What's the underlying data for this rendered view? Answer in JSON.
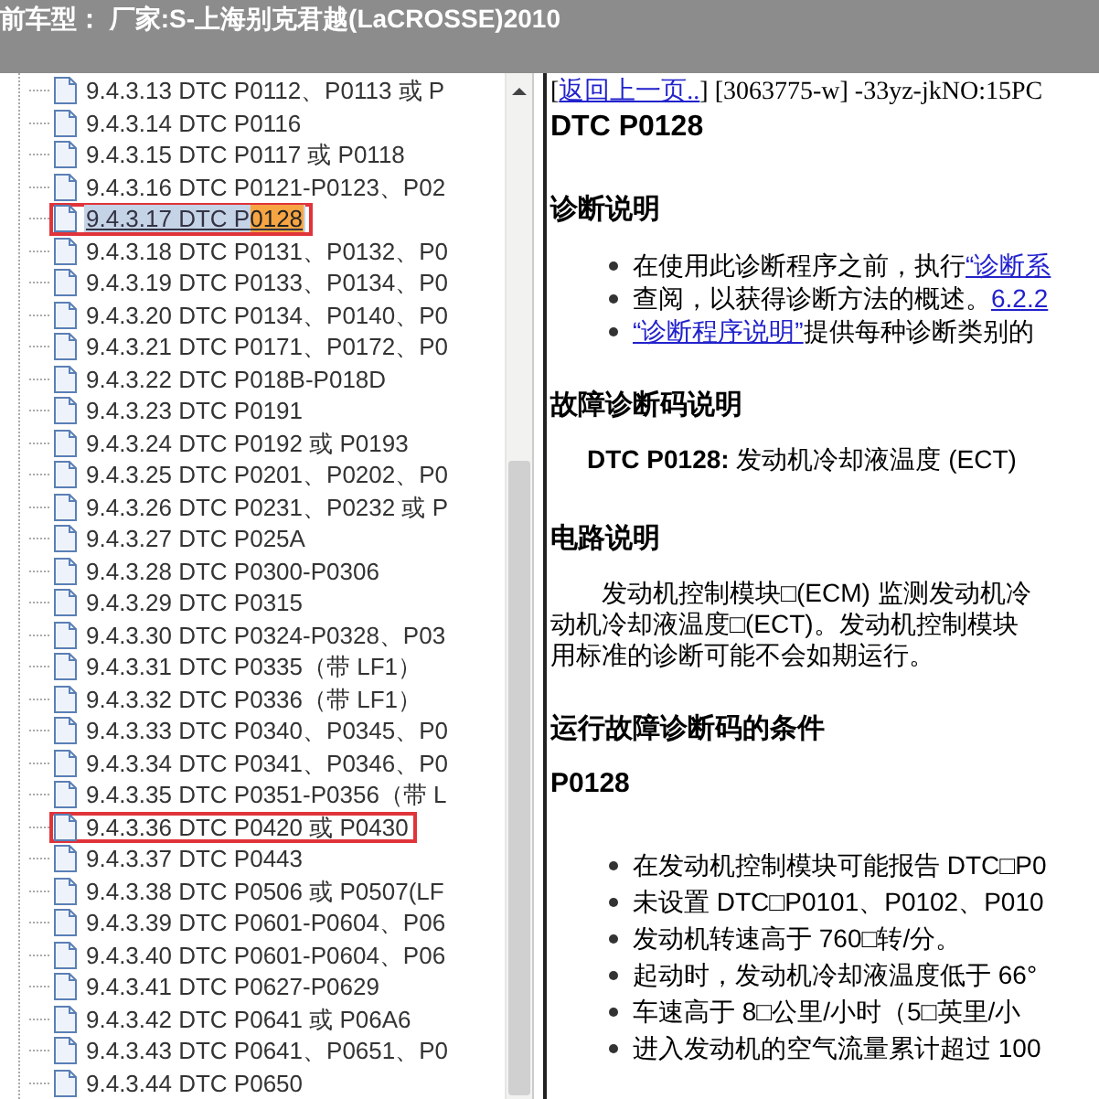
{
  "window": {
    "title": "前车型：  厂家:S-上海别克君越(LaCROSSE)2010"
  },
  "tree": {
    "items": [
      {
        "label": "9.4.3.13 DTC P0112、P0113 或 P",
        "selected": false,
        "boxed": false
      },
      {
        "label": "9.4.3.14 DTC P0116",
        "selected": false,
        "boxed": false
      },
      {
        "label": "9.4.3.15 DTC P0117 或 P0118",
        "selected": false,
        "boxed": false
      },
      {
        "label": "9.4.3.16 DTC P0121-P0123、P02",
        "selected": false,
        "boxed": false
      },
      {
        "label": "9.4.3.17 DTC P",
        "match": "0128",
        "selected": true,
        "boxed": true
      },
      {
        "label": "9.4.3.18 DTC P0131、P0132、P0",
        "selected": false,
        "boxed": false
      },
      {
        "label": "9.4.3.19 DTC P0133、P0134、P0",
        "selected": false,
        "boxed": false
      },
      {
        "label": "9.4.3.20 DTC P0134、P0140、P0",
        "selected": false,
        "boxed": false
      },
      {
        "label": "9.4.3.21 DTC P0171、P0172、P0",
        "selected": false,
        "boxed": false
      },
      {
        "label": "9.4.3.22 DTC P018B-P018D",
        "selected": false,
        "boxed": false
      },
      {
        "label": "9.4.3.23 DTC P0191",
        "selected": false,
        "boxed": false
      },
      {
        "label": "9.4.3.24 DTC P0192 或 P0193",
        "selected": false,
        "boxed": false
      },
      {
        "label": "9.4.3.25 DTC P0201、P0202、P0",
        "selected": false,
        "boxed": false
      },
      {
        "label": "9.4.3.26 DTC P0231、P0232 或 P",
        "selected": false,
        "boxed": false
      },
      {
        "label": "9.4.3.27 DTC P025A",
        "selected": false,
        "boxed": false
      },
      {
        "label": "9.4.3.28 DTC P0300-P0306",
        "selected": false,
        "boxed": false
      },
      {
        "label": "9.4.3.29 DTC P0315",
        "selected": false,
        "boxed": false
      },
      {
        "label": "9.4.3.30 DTC P0324-P0328、P03",
        "selected": false,
        "boxed": false
      },
      {
        "label": "9.4.3.31 DTC P0335（带 LF1）",
        "selected": false,
        "boxed": false
      },
      {
        "label": "9.4.3.32 DTC P0336（带 LF1）",
        "selected": false,
        "boxed": false
      },
      {
        "label": "9.4.3.33 DTC P0340、P0345、P0",
        "selected": false,
        "boxed": false
      },
      {
        "label": "9.4.3.34 DTC P0341、P0346、P0",
        "selected": false,
        "boxed": false
      },
      {
        "label": "9.4.3.35 DTC P0351-P0356（带 L",
        "selected": false,
        "boxed": false
      },
      {
        "label": "9.4.3.36 DTC P0420 或 P0430",
        "selected": false,
        "boxed": true
      },
      {
        "label": "9.4.3.37 DTC P0443",
        "selected": false,
        "boxed": false
      },
      {
        "label": "9.4.3.38 DTC P0506 或 P0507(LF",
        "selected": false,
        "boxed": false
      },
      {
        "label": "9.4.3.39 DTC P0601-P0604、P06",
        "selected": false,
        "boxed": false
      },
      {
        "label": "9.4.3.40 DTC P0601-P0604、P06",
        "selected": false,
        "boxed": false
      },
      {
        "label": "9.4.3.41 DTC P0627-P0629",
        "selected": false,
        "boxed": false
      },
      {
        "label": "9.4.3.42 DTC P0641 或 P06A6",
        "selected": false,
        "boxed": false
      },
      {
        "label": "9.4.3.43 DTC P0641、P0651、P0",
        "selected": false,
        "boxed": false
      },
      {
        "label": "9.4.3.44 DTC P0650",
        "selected": false,
        "boxed": false
      }
    ]
  },
  "document": {
    "open_bracket": "[",
    "back_link": "返回上一页..",
    "ref": "] [3063775-w] -33yz-jkNO:15PC",
    "title": "DTC P0128",
    "blocks": [
      {
        "kind": "heading",
        "text": "诊断说明"
      },
      {
        "kind": "bullet",
        "parts": [
          {
            "text": "在使用此诊断程序之前，执行",
            "link": false
          },
          {
            "text": "“诊断系",
            "link": true
          }
        ]
      },
      {
        "kind": "bullet",
        "parts": [
          {
            "text": "查阅，以获得诊断方法的概述。",
            "link": false
          },
          {
            "text": "6.2.2",
            "link": true
          }
        ]
      },
      {
        "kind": "bullet",
        "parts": [
          {
            "text": "“诊断程序说明”",
            "link": true
          },
          {
            "text": "提供每种诊断类别的",
            "link": false
          }
        ]
      },
      {
        "kind": "heading",
        "text": "故障诊断码说明"
      },
      {
        "kind": "definition",
        "term": "DTC P0128:",
        "text": " 发动机冷却液温度 (ECT)"
      },
      {
        "kind": "heading",
        "text": "电路说明"
      },
      {
        "kind": "paragraph",
        "lines": [
          "发动机控制模块□(ECM) 监测发动机冷",
          "动机冷却液温度□(ECT)。发动机控制模块",
          "用标准的诊断可能不会如期运行。"
        ]
      },
      {
        "kind": "heading",
        "text": "运行故障诊断码的条件"
      },
      {
        "kind": "subheading",
        "text": "P0128"
      },
      {
        "kind": "bullet",
        "parts": [
          {
            "text": "在发动机控制模块可能报告 DTC□P0",
            "link": false
          }
        ]
      },
      {
        "kind": "bullet",
        "parts": [
          {
            "text": "未设置 DTC□P0101、P0102、P010",
            "link": false
          }
        ]
      },
      {
        "kind": "bullet",
        "parts": [
          {
            "text": "发动机转速高于 760□转/分。",
            "link": false
          }
        ]
      },
      {
        "kind": "bullet",
        "parts": [
          {
            "text": "起动时，发动机冷却液温度低于 66°",
            "link": false
          }
        ]
      },
      {
        "kind": "bullet",
        "parts": [
          {
            "text": "车速高于 8□公里/小时（5□英里/小",
            "link": false
          }
        ]
      },
      {
        "kind": "bullet",
        "parts": [
          {
            "text": "进入发动机的空气流量累计超过 100",
            "link": false
          }
        ]
      }
    ]
  }
}
